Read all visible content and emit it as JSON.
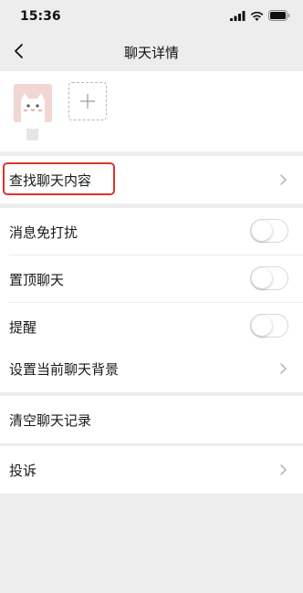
{
  "status_bar": {
    "time": "15:36",
    "icons": [
      "signal-icon",
      "wifi-icon",
      "battery-icon"
    ]
  },
  "nav": {
    "back_icon": "chevron-left-icon",
    "title": "聊天详情"
  },
  "members": {
    "add_icon": "plus-icon"
  },
  "menu": {
    "search_history": "查找聊天内容",
    "mute": "消息免打扰",
    "mute_on": false,
    "sticky": "置顶聊天",
    "sticky_on": false,
    "remind": "提醒",
    "remind_on": false,
    "set_background": "设置当前聊天背景",
    "clear_history": "清空聊天记录",
    "report": "投诉"
  },
  "colors": {
    "background": "#ededed",
    "cell": "#ffffff",
    "highlight": "#e0322d",
    "chevron": "#b2b2b2"
  }
}
